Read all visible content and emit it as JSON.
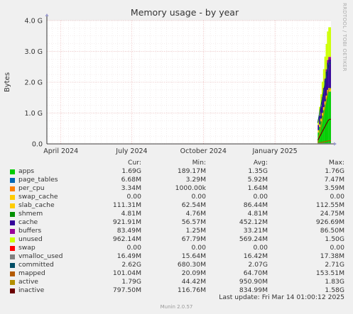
{
  "chart_data": {
    "type": "area",
    "title": "Memory usage - by year",
    "ylabel": "Bytes",
    "side_label": "RRDTOOL / TOBI OETIKER",
    "ylim": [
      0,
      4000000000
    ],
    "y_ticks": [
      {
        "value": 0,
        "label": "0.0"
      },
      {
        "value": 1000000000,
        "label": "1.0 G"
      },
      {
        "value": 2000000000,
        "label": "2.0 G"
      },
      {
        "value": 3000000000,
        "label": "3.0 G"
      },
      {
        "value": 4000000000,
        "label": "4.0 G"
      }
    ],
    "x_range": [
      "2024-03-14",
      "2025-03-14"
    ],
    "x_ticks": [
      {
        "date": "2024-04-01",
        "label": "April 2024"
      },
      {
        "date": "2024-07-01",
        "label": "July 2024"
      },
      {
        "date": "2024-10-01",
        "label": "October 2024"
      },
      {
        "date": "2025-01-01",
        "label": "January 2025"
      }
    ],
    "data_start": "2025-02-25",
    "columns": [
      "Cur:",
      "Min:",
      "Avg:",
      "Max:"
    ],
    "series": [
      {
        "name": "apps",
        "color": "#00cc00",
        "cur": "1.69G",
        "min": "189.17M",
        "avg": "1.35G",
        "max": "1.76G"
      },
      {
        "name": "page_tables",
        "color": "#0066b3",
        "cur": "6.68M",
        "min": "3.29M",
        "avg": "5.92M",
        "max": "7.47M"
      },
      {
        "name": "per_cpu",
        "color": "#ff8000",
        "cur": "3.34M",
        "min": "1000.00k",
        "avg": "1.64M",
        "max": "3.59M"
      },
      {
        "name": "swap_cache",
        "color": "#ffcc00",
        "cur": "0.00",
        "min": "0.00",
        "avg": "0.00",
        "max": "0.00"
      },
      {
        "name": "slab_cache",
        "color": "#ffcc00",
        "cur": "111.31M",
        "min": "62.54M",
        "avg": "86.44M",
        "max": "112.55M"
      },
      {
        "name": "shmem",
        "color": "#008f00",
        "cur": "4.81M",
        "min": "4.76M",
        "avg": "4.81M",
        "max": "24.75M"
      },
      {
        "name": "cache",
        "color": "#330099",
        "cur": "921.91M",
        "min": "56.57M",
        "avg": "452.12M",
        "max": "926.69M"
      },
      {
        "name": "buffers",
        "color": "#990099",
        "cur": "83.49M",
        "min": "1.25M",
        "avg": "33.21M",
        "max": "86.50M"
      },
      {
        "name": "unused",
        "color": "#ccff00",
        "cur": "962.14M",
        "min": "67.79M",
        "avg": "569.24M",
        "max": "1.50G"
      },
      {
        "name": "swap",
        "color": "#ff0000",
        "cur": "0.00",
        "min": "0.00",
        "avg": "0.00",
        "max": "0.00"
      },
      {
        "name": "vmalloc_used",
        "color": "#808080",
        "cur": "16.49M",
        "min": "15.64M",
        "avg": "16.42M",
        "max": "17.38M"
      },
      {
        "name": "committed",
        "color": "#004d66",
        "cur": "2.62G",
        "min": "680.30M",
        "avg": "2.07G",
        "max": "2.71G"
      },
      {
        "name": "mapped",
        "color": "#b35a00",
        "cur": "101.04M",
        "min": "20.09M",
        "avg": "64.70M",
        "max": "153.51M"
      },
      {
        "name": "active",
        "color": "#b38f00",
        "cur": "1.79G",
        "min": "44.42M",
        "avg": "950.90M",
        "max": "1.83G"
      },
      {
        "name": "inactive",
        "color": "#6b0000",
        "cur": "797.50M",
        "min": "116.76M",
        "avg": "834.99M",
        "max": "1.58G"
      }
    ],
    "last_update": "Last update: Fri Mar 14 01:00:12 2025",
    "version": "Munin 2.0.57"
  }
}
